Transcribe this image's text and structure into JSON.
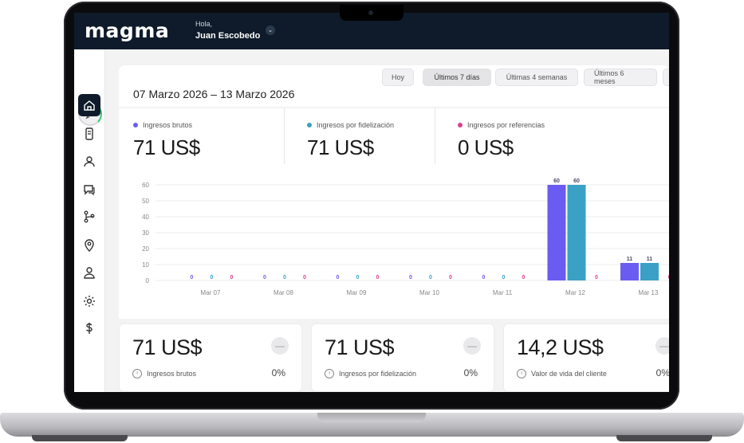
{
  "app": {
    "logo": "magma",
    "greeting": "Hola,",
    "user_name": "Juan Escobedo",
    "dropdown_glyph": "⌄"
  },
  "sidebar": {
    "items": [
      {
        "name": "sidebar-item-home",
        "icon": "home-icon",
        "active": true
      },
      {
        "name": "sidebar-item-mobile",
        "icon": "mobile-card-icon",
        "active": false
      },
      {
        "name": "sidebar-item-customers",
        "icon": "users-icon",
        "active": false
      },
      {
        "name": "sidebar-item-messages",
        "icon": "chat-icon",
        "active": false
      },
      {
        "name": "sidebar-item-flows",
        "icon": "branch-icon",
        "active": false
      },
      {
        "name": "sidebar-item-locations",
        "icon": "location-pin-icon",
        "active": false
      },
      {
        "name": "sidebar-item-profile",
        "icon": "user-icon",
        "active": false
      },
      {
        "name": "sidebar-item-settings",
        "icon": "gear-icon",
        "active": false
      },
      {
        "name": "sidebar-item-billing",
        "icon": "dollar-icon",
        "active": false
      }
    ]
  },
  "date_range": "07 Marzo 2026 – 13 Marzo 2026",
  "range_buttons": [
    {
      "label": "Hoy",
      "selected": false
    },
    {
      "label": "Últimos 7 días",
      "selected": true
    },
    {
      "label": "Últimas 4 semanas",
      "selected": false
    },
    {
      "label": "Últimos 6 meses",
      "selected": false
    }
  ],
  "metrics": [
    {
      "label": "Ingresos brutos",
      "value": "71 US$",
      "color": "#6a5cf0"
    },
    {
      "label": "Ingresos por fidelización",
      "value": "71 US$",
      "color": "#3aa0c4"
    },
    {
      "label": "Ingresos por referencias",
      "value": "0 US$",
      "color": "#d9418e"
    }
  ],
  "chart_data": {
    "type": "bar",
    "categories": [
      "Mar 07",
      "Mar 08",
      "Mar 09",
      "Mar 10",
      "Mar 11",
      "Mar 12",
      "Mar 13"
    ],
    "series": [
      {
        "name": "Ingresos brutos",
        "values": [
          0,
          0,
          0,
          0,
          0,
          60,
          11
        ],
        "color": "#6a5cf0"
      },
      {
        "name": "Ingresos por fidelización",
        "values": [
          0,
          0,
          0,
          0,
          0,
          60,
          11
        ],
        "color": "#3aa0c4"
      },
      {
        "name": "Ingresos por referencias",
        "values": [
          0,
          0,
          0,
          0,
          0,
          0,
          0
        ],
        "color": "#d9418e"
      }
    ],
    "yticks": [
      0,
      10,
      20,
      30,
      40,
      50,
      60
    ],
    "ylim": [
      0,
      60
    ],
    "grid": true
  },
  "kpis": [
    {
      "value": "71 US$",
      "label": "Ingresos brutos",
      "pct": "0%"
    },
    {
      "value": "71 US$",
      "label": "Ingresos por fidelización",
      "pct": "0%"
    },
    {
      "value": "14,2 US$",
      "label": "Valor de vida del cliente",
      "pct": "0%"
    }
  ],
  "kpi_trend_glyph": "—",
  "info_glyph": "i"
}
